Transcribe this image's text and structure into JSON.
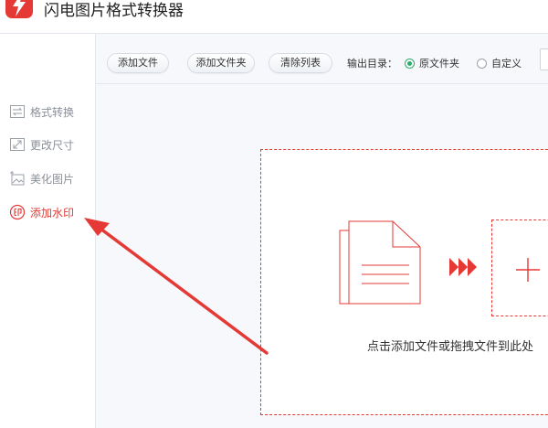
{
  "app": {
    "title": "闪电图片格式转换器",
    "logo_icon": "lightning-logo-icon"
  },
  "sidebar": {
    "items": [
      {
        "label": "格式转换",
        "icon": "swap-arrows-icon",
        "active": false
      },
      {
        "label": "更改尺寸",
        "icon": "resize-icon",
        "active": false
      },
      {
        "label": "美化图片",
        "icon": "image-beautify-icon",
        "active": false
      },
      {
        "label": "添加水印",
        "icon": "watermark-stamp-icon",
        "active": true
      }
    ]
  },
  "toolbar": {
    "add_file_label": "添加文件",
    "add_folder_label": "添加文件夹",
    "clear_list_label": "清除列表",
    "output_dir_label": "输出目录：",
    "output_options": [
      {
        "label": "原文件夹",
        "checked": true
      },
      {
        "label": "自定义",
        "checked": false
      }
    ]
  },
  "dropzone": {
    "hint": "点击添加文件或拖拽文件到此处",
    "icons": [
      "document-icon",
      "triple-arrow-icon",
      "plus-icon"
    ]
  },
  "colors": {
    "accent": "#e53935",
    "radio_checked": "#2eaa6a",
    "muted_text": "#8a8f99",
    "workarea_bg": "#f6f8fb"
  }
}
